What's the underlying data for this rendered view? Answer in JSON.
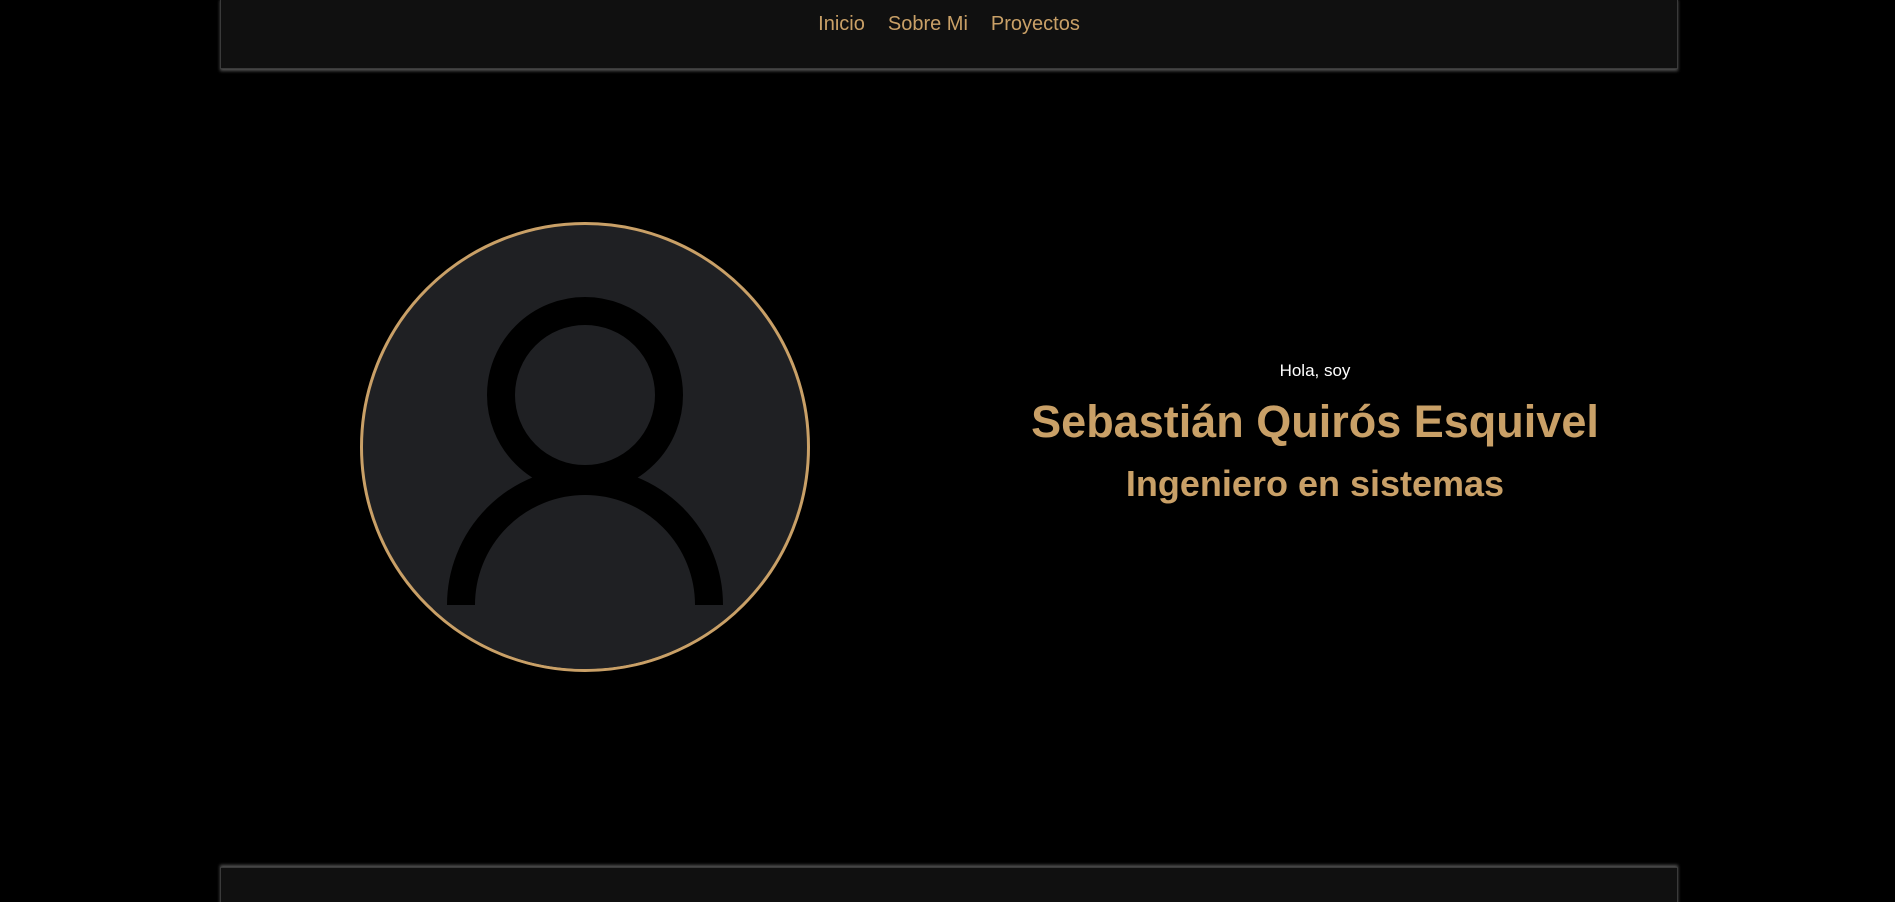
{
  "nav": {
    "links": [
      "Inicio",
      "Sobre Mi",
      "Proyectos"
    ]
  },
  "hero": {
    "greeting": "Hola, soy",
    "name": "Sebastián Quirós Esquivel",
    "role": "Ingeniero en sistemas",
    "avatar_icon": "user-placeholder-icon"
  },
  "colors": {
    "accent": "#c9a067",
    "background": "#000000",
    "bar": "#101010",
    "avatar_bg": "#1f2023",
    "text": "#ffffff"
  }
}
